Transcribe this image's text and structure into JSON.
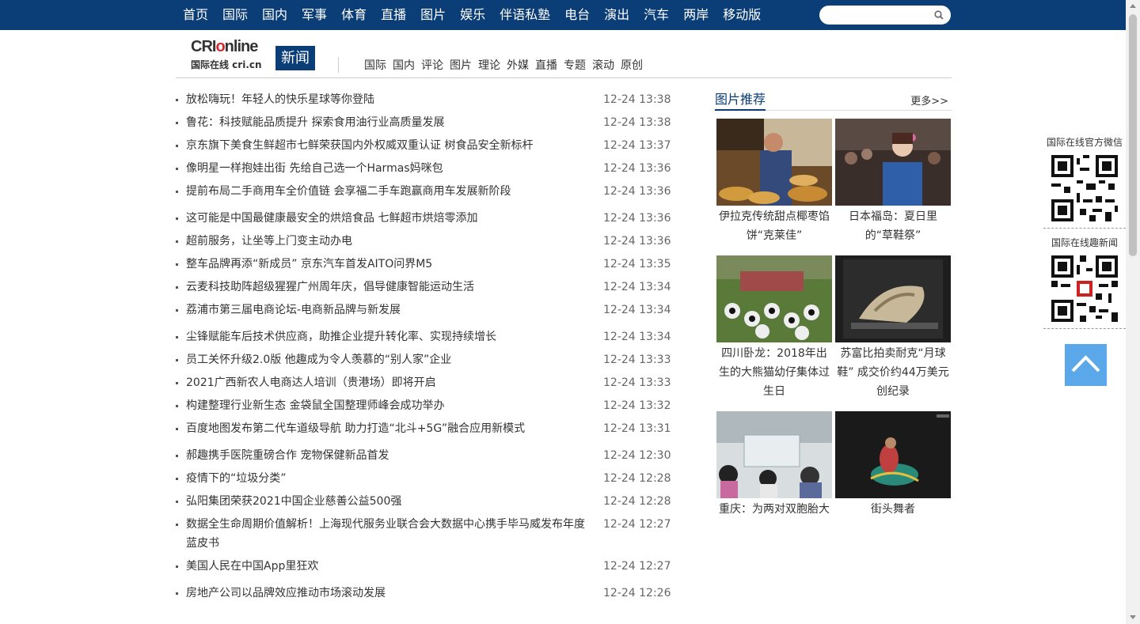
{
  "topnav": [
    "首页",
    "国际",
    "国内",
    "军事",
    "体育",
    "直播",
    "图片",
    "娱乐",
    "伴语私塾",
    "电台",
    "演出",
    "汽车",
    "两岸",
    "移动版"
  ],
  "search": {
    "placeholder": ""
  },
  "logo": {
    "brand_a": "CRI",
    "brand_o": "o",
    "brand_b": "nline",
    "sub": "国际在线 cri.cn",
    "badge": "新闻"
  },
  "subnav": [
    "国际",
    "国内",
    "评论",
    "图片",
    "理论",
    "外媒",
    "直播",
    "专题",
    "滚动",
    "原创"
  ],
  "news_groups": [
    [
      {
        "title": "放松嗨玩！年轻人的快乐星球等你登陆",
        "date": "12-24 13:38"
      },
      {
        "title": "鲁花：科技赋能品质提升 探索食用油行业高质量发展",
        "date": "12-24 13:38"
      },
      {
        "title": "京东旗下美食生鲜超市七鲜荣获国内外权威双重认证 树食品安全新标杆",
        "date": "12-24 13:37"
      },
      {
        "title": "像明星一样抱娃出街 先给自己选一个Harmas妈咪包",
        "date": "12-24 13:36"
      },
      {
        "title": "提前布局二手商用车全价值链 会享福二手车跑赢商用车发展新阶段",
        "date": "12-24 13:36"
      }
    ],
    [
      {
        "title": "这可能是中国最健康最安全的烘焙食品 七鲜超市烘焙零添加",
        "date": "12-24 13:36"
      },
      {
        "title": "超前服务，让坐等上门变主动办电",
        "date": "12-24 13:36"
      },
      {
        "title": "整车品牌再添“新成员” 京东汽车首发AITO问界M5",
        "date": "12-24 13:35"
      },
      {
        "title": "云麦科技助阵超级猩猩广州周年庆，倡导健康智能运动生活",
        "date": "12-24 13:34"
      },
      {
        "title": "荔浦市第三届电商论坛-电商新品牌与新发展",
        "date": "12-24 13:34"
      }
    ],
    [
      {
        "title": "尘锋赋能车后技术供应商，助推企业提升转化率、实现持续增长",
        "date": "12-24 13:34"
      },
      {
        "title": "员工关怀升级2.0版 他趣成为令人羡慕的“别人家”企业",
        "date": "12-24 13:33"
      },
      {
        "title": "2021广西新农人电商达人培训（贵港场）即将开启",
        "date": "12-24 13:33"
      },
      {
        "title": "构建整理行业新生态 金袋鼠全国整理师峰会成功举办",
        "date": "12-24 13:32"
      },
      {
        "title": "百度地图发布第二代车道级导航 助力打造“北斗+5G”融合应用新模式",
        "date": "12-24 13:31"
      }
    ],
    [
      {
        "title": "郝趣携手医院重磅合作 宠物保健新品首发",
        "date": "12-24 12:30"
      },
      {
        "title": "疫情下的“垃圾分类”",
        "date": "12-24 12:28"
      },
      {
        "title": "弘阳集团荣获2021中国企业慈善公益500强",
        "date": "12-24 12:28"
      },
      {
        "title": "数据全生命周期价值解析！上海现代服务业联合会大数据中心携手毕马威发布年度蓝皮书",
        "date": "12-24 12:27"
      },
      {
        "title": "美国人民在中国App里狂欢",
        "date": "12-24 12:27"
      }
    ],
    [
      {
        "title": "房地产公司以品牌效应推动市场滚动发展",
        "date": "12-24 12:26"
      }
    ]
  ],
  "photos": {
    "title": "图片推荐",
    "more": "更多>>",
    "items": [
      {
        "caption": "伊拉克传统甜点椰枣馅饼“克莱佳”"
      },
      {
        "caption": "日本福岛：夏日里的“草鞋祭”"
      },
      {
        "caption": "四川卧龙：2018年出生的大熊猫幼仔集体过生日"
      },
      {
        "caption": "苏富比拍卖耐克“月球鞋” 成交价约44万美元创纪录"
      },
      {
        "caption": "重庆：为两对双胞胎大"
      },
      {
        "caption": "街头舞者"
      }
    ]
  },
  "side": {
    "wechat_label": "国际在线官方微信",
    "news_label": "国际在线趣新闻"
  }
}
